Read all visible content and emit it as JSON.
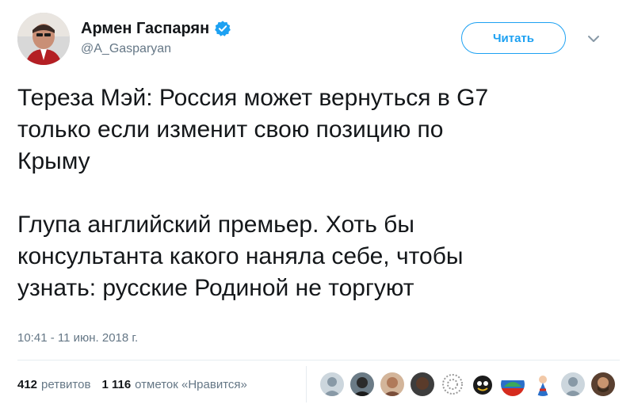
{
  "author": {
    "display_name": "Армен Гаспарян",
    "handle": "@A_Gasparyan",
    "verified": true
  },
  "actions": {
    "follow_label": "Читать"
  },
  "tweet": {
    "paragraph1_lines": [
      "Тереза Мэй: Россия может вернуться в G7",
      "только если изменит свою позицию по",
      "Крыму"
    ],
    "paragraph2_lines": [
      "Глупа английский премьер. Хоть бы",
      "консультанта какого наняла себе, чтобы",
      "узнать: русские Родиной не торгуют"
    ],
    "timestamp": "10:41 - 11 июн. 2018 г."
  },
  "stats": {
    "retweets_count": "412",
    "retweets_label": "ретвитов",
    "likes_count": "1 116",
    "likes_label": "отметок «Нравится»"
  },
  "colors": {
    "accent": "#1da1f2",
    "text": "#14171a",
    "secondary_text": "#657786",
    "divider": "#e6ecf0"
  },
  "liker_avatars": [
    "avatar-1",
    "avatar-2",
    "avatar-3",
    "avatar-4",
    "avatar-5",
    "avatar-6",
    "avatar-7",
    "avatar-8",
    "avatar-9"
  ]
}
